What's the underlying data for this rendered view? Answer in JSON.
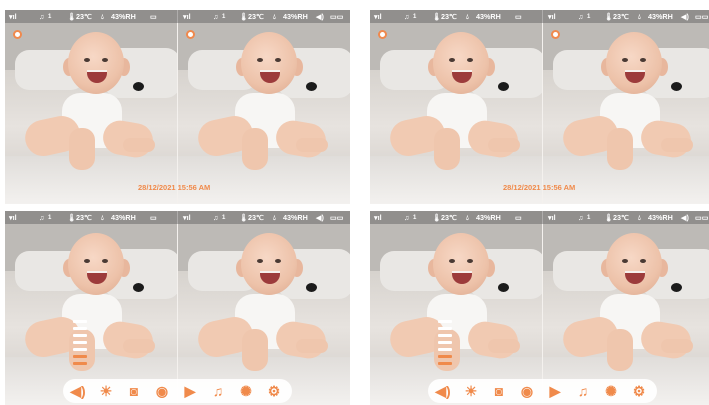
{
  "status_bar": {
    "channel_left": "1",
    "temperature": "23℃",
    "humidity": "43%RH"
  },
  "timestamp": "28/12/2021 15:56 AM",
  "volume": {
    "level": 0.3
  },
  "toolbar_items": [
    {
      "name": "volume-icon"
    },
    {
      "name": "brightness-icon"
    },
    {
      "name": "camera-icon"
    },
    {
      "name": "video-camera-icon"
    },
    {
      "name": "playback-icon"
    },
    {
      "name": "music-icon"
    },
    {
      "name": "night-light-icon"
    },
    {
      "name": "settings-icon"
    }
  ],
  "colors": {
    "accent": "#f08a4b",
    "statusbar": "#5a5a5a"
  }
}
